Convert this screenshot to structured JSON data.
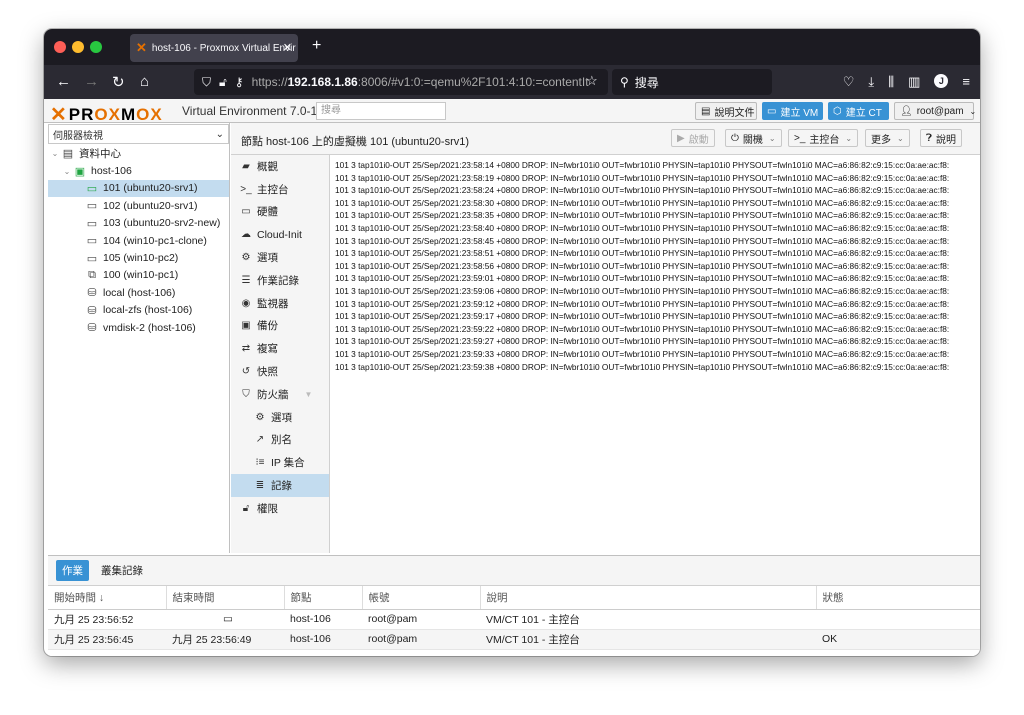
{
  "browser": {
    "tab_title": "host-106 - Proxmox Virtual Envir",
    "url_prefix": "https://",
    "url_host": "192.168.1.86",
    "url_rest": ":8006/#v1:0:=qemu%2F101:4:10:=contentIt",
    "search_label": "搜尋"
  },
  "header": {
    "logo_pro": "PR",
    "logo_ox1": "OX",
    "logo_m": "M",
    "logo_ox2": "OX",
    "version": "Virtual Environment 7.0-11",
    "search_placeholder": "搜尋",
    "doc_label": "說明文件",
    "create_vm_label": "建立 VM",
    "create_ct_label": "建立 CT",
    "user_label": "root@pam"
  },
  "tree": {
    "view_selector": "伺服器檢視",
    "items": [
      {
        "label": "資料中心",
        "icon": "datacenter-icon",
        "indent": 0,
        "twisty": "⌄"
      },
      {
        "label": "host-106",
        "icon": "node-icon",
        "indent": 1,
        "twisty": "⌄"
      },
      {
        "label": "101 (ubuntu20-srv1)",
        "icon": "vm-running-icon",
        "indent": 2,
        "twisty": ""
      },
      {
        "label": "102 (ubuntu20-srv1)",
        "icon": "vm-icon",
        "indent": 2,
        "twisty": ""
      },
      {
        "label": "103 (ubuntu20-srv2-new)",
        "icon": "vm-icon",
        "indent": 2,
        "twisty": ""
      },
      {
        "label": "104 (win10-pc1-clone)",
        "icon": "vm-icon",
        "indent": 2,
        "twisty": ""
      },
      {
        "label": "105 (win10-pc2)",
        "icon": "vm-icon",
        "indent": 2,
        "twisty": ""
      },
      {
        "label": "100 (win10-pc1)",
        "icon": "template-icon",
        "indent": 2,
        "twisty": ""
      },
      {
        "label": "local (host-106)",
        "icon": "storage-icon",
        "indent": 2,
        "twisty": ""
      },
      {
        "label": "local-zfs (host-106)",
        "icon": "storage-icon",
        "indent": 2,
        "twisty": ""
      },
      {
        "label": "vmdisk-2 (host-106)",
        "icon": "storage-icon",
        "indent": 2,
        "twisty": ""
      }
    ]
  },
  "main": {
    "title": "節點 host-106 上的虛擬機 101 (ubuntu20-srv1)",
    "start_label": "啟動",
    "shutdown_label": "關機",
    "console_label": "主控台",
    "more_label": "更多",
    "help_label": "說明"
  },
  "menu": [
    {
      "label": "概觀",
      "icon": "summary-icon"
    },
    {
      "label": "主控台",
      "icon": "console-icon"
    },
    {
      "label": "硬體",
      "icon": "hardware-icon"
    },
    {
      "label": "Cloud-Init",
      "icon": "cloud-icon"
    },
    {
      "label": "選項",
      "icon": "gear-icon"
    },
    {
      "label": "作業記錄",
      "icon": "task-history-icon"
    },
    {
      "label": "監視器",
      "icon": "eye-icon"
    },
    {
      "label": "備份",
      "icon": "floppy-icon"
    },
    {
      "label": "複寫",
      "icon": "retweet-icon"
    },
    {
      "label": "快照",
      "icon": "history-icon"
    },
    {
      "label": "防火牆",
      "icon": "shield-icon"
    },
    {
      "label": "選項",
      "icon": "gear-icon"
    },
    {
      "label": "別名",
      "icon": "external-link-icon"
    },
    {
      "label": "IP 集合",
      "icon": "list-ol-icon"
    },
    {
      "label": "記錄",
      "icon": "list-icon"
    },
    {
      "label": "權限",
      "icon": "unlock-icon"
    }
  ],
  "log": [
    "101 3 tap101i0-OUT 25/Sep/2021:23:58:14 +0800 DROP: IN=fwbr101i0 OUT=fwbr101i0 PHYSIN=tap101i0 PHYSOUT=fwln101i0 MAC=a6:86:82:c9:15:cc:0a:ae:ac:f8:",
    "101 3 tap101i0-OUT 25/Sep/2021:23:58:19 +0800 DROP: IN=fwbr101i0 OUT=fwbr101i0 PHYSIN=tap101i0 PHYSOUT=fwln101i0 MAC=a6:86:82:c9:15:cc:0a:ae:ac:f8:",
    "101 3 tap101i0-OUT 25/Sep/2021:23:58:24 +0800 DROP: IN=fwbr101i0 OUT=fwbr101i0 PHYSIN=tap101i0 PHYSOUT=fwln101i0 MAC=a6:86:82:c9:15:cc:0a:ae:ac:f8:",
    "101 3 tap101i0-OUT 25/Sep/2021:23:58:30 +0800 DROP: IN=fwbr101i0 OUT=fwbr101i0 PHYSIN=tap101i0 PHYSOUT=fwln101i0 MAC=a6:86:82:c9:15:cc:0a:ae:ac:f8:",
    "101 3 tap101i0-OUT 25/Sep/2021:23:58:35 +0800 DROP: IN=fwbr101i0 OUT=fwbr101i0 PHYSIN=tap101i0 PHYSOUT=fwln101i0 MAC=a6:86:82:c9:15:cc:0a:ae:ac:f8:",
    "101 3 tap101i0-OUT 25/Sep/2021:23:58:40 +0800 DROP: IN=fwbr101i0 OUT=fwbr101i0 PHYSIN=tap101i0 PHYSOUT=fwln101i0 MAC=a6:86:82:c9:15:cc:0a:ae:ac:f8:",
    "101 3 tap101i0-OUT 25/Sep/2021:23:58:45 +0800 DROP: IN=fwbr101i0 OUT=fwbr101i0 PHYSIN=tap101i0 PHYSOUT=fwln101i0 MAC=a6:86:82:c9:15:cc:0a:ae:ac:f8:",
    "101 3 tap101i0-OUT 25/Sep/2021:23:58:51 +0800 DROP: IN=fwbr101i0 OUT=fwbr101i0 PHYSIN=tap101i0 PHYSOUT=fwln101i0 MAC=a6:86:82:c9:15:cc:0a:ae:ac:f8:",
    "101 3 tap101i0-OUT 25/Sep/2021:23:58:56 +0800 DROP: IN=fwbr101i0 OUT=fwbr101i0 PHYSIN=tap101i0 PHYSOUT=fwln101i0 MAC=a6:86:82:c9:15:cc:0a:ae:ac:f8:",
    "101 3 tap101i0-OUT 25/Sep/2021:23:59:01 +0800 DROP: IN=fwbr101i0 OUT=fwbr101i0 PHYSIN=tap101i0 PHYSOUT=fwln101i0 MAC=a6:86:82:c9:15:cc:0a:ae:ac:f8:",
    "101 3 tap101i0-OUT 25/Sep/2021:23:59:06 +0800 DROP: IN=fwbr101i0 OUT=fwbr101i0 PHYSIN=tap101i0 PHYSOUT=fwln101i0 MAC=a6:86:82:c9:15:cc:0a:ae:ac:f8:",
    "101 3 tap101i0-OUT 25/Sep/2021:23:59:12 +0800 DROP: IN=fwbr101i0 OUT=fwbr101i0 PHYSIN=tap101i0 PHYSOUT=fwln101i0 MAC=a6:86:82:c9:15:cc:0a:ae:ac:f8:",
    "101 3 tap101i0-OUT 25/Sep/2021:23:59:17 +0800 DROP: IN=fwbr101i0 OUT=fwbr101i0 PHYSIN=tap101i0 PHYSOUT=fwln101i0 MAC=a6:86:82:c9:15:cc:0a:ae:ac:f8:",
    "101 3 tap101i0-OUT 25/Sep/2021:23:59:22 +0800 DROP: IN=fwbr101i0 OUT=fwbr101i0 PHYSIN=tap101i0 PHYSOUT=fwln101i0 MAC=a6:86:82:c9:15:cc:0a:ae:ac:f8:",
    "101 3 tap101i0-OUT 25/Sep/2021:23:59:27 +0800 DROP: IN=fwbr101i0 OUT=fwbr101i0 PHYSIN=tap101i0 PHYSOUT=fwln101i0 MAC=a6:86:82:c9:15:cc:0a:ae:ac:f8:",
    "101 3 tap101i0-OUT 25/Sep/2021:23:59:33 +0800 DROP: IN=fwbr101i0 OUT=fwbr101i0 PHYSIN=tap101i0 PHYSOUT=fwln101i0 MAC=a6:86:82:c9:15:cc:0a:ae:ac:f8:",
    "101 3 tap101i0-OUT 25/Sep/2021:23:59:38 +0800 DROP: IN=fwbr101i0 OUT=fwbr101i0 PHYSIN=tap101i0 PHYSOUT=fwln101i0 MAC=a6:86:82:c9:15:cc:0a:ae:ac:f8:"
  ],
  "tasks": {
    "tab_tasks": "作業",
    "tab_cluster_log": "叢集記錄",
    "columns": [
      "開始時間 ↓",
      "結束時間",
      "節點",
      "帳號",
      "說明",
      "狀態"
    ],
    "rows": [
      {
        "start": "九月 25 23:56:52",
        "end": "",
        "node": "host-106",
        "user": "root@pam",
        "desc": "VM/CT 101 - 主控台",
        "status": ""
      },
      {
        "start": "九月 25 23:56:45",
        "end": "九月 25 23:56:49",
        "node": "host-106",
        "user": "root@pam",
        "desc": "VM/CT 101 - 主控台",
        "status": "OK"
      }
    ]
  }
}
